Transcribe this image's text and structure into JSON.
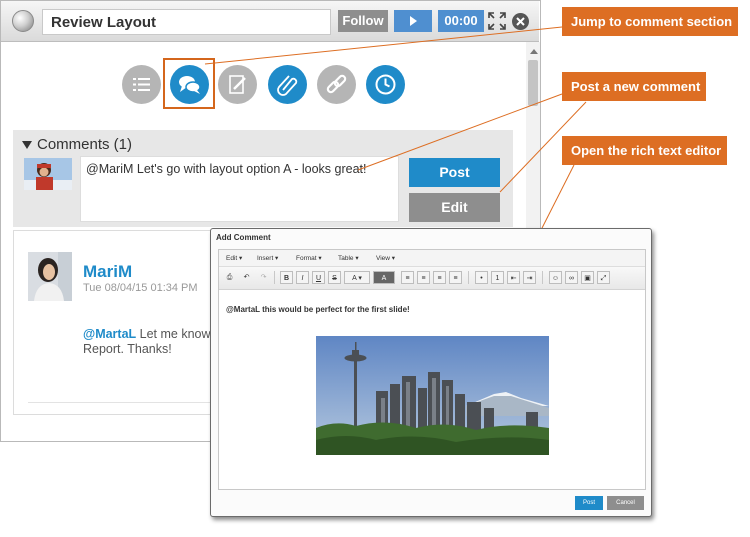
{
  "window": {
    "title": "Review Layout",
    "follow_label": "Follow",
    "timer": "00:00"
  },
  "tools": {
    "items": [
      "list",
      "comments",
      "edit",
      "attach",
      "link",
      "history"
    ]
  },
  "comments": {
    "header": "Comments (1)",
    "input_text": "@MariM Let's go with layout option A - looks great!",
    "post_label": "Post",
    "edit_label": "Edit"
  },
  "thread": {
    "author": "MariM",
    "timestamp": "Tue 08/04/15 01:34 PM",
    "mention": "@MartaL",
    "body_text": " Let me know Report. Thanks!"
  },
  "callouts": {
    "jump": "Jump to comment section",
    "post": "Post a new comment",
    "editor": "Open the rich text editor"
  },
  "dialog": {
    "title": "Add Comment",
    "menus": [
      "Edit ▾",
      "Insert ▾",
      "Format ▾",
      "Table ▾",
      "View ▾"
    ],
    "editor_text": "@MartaL this would be perfect for the first slide!",
    "post_label": "Post",
    "cancel_label": "Cancel"
  },
  "colors": {
    "accent_blue": "#1f8bc9",
    "callout_orange": "#dd6e23",
    "button_gray": "#8e8e8e"
  }
}
